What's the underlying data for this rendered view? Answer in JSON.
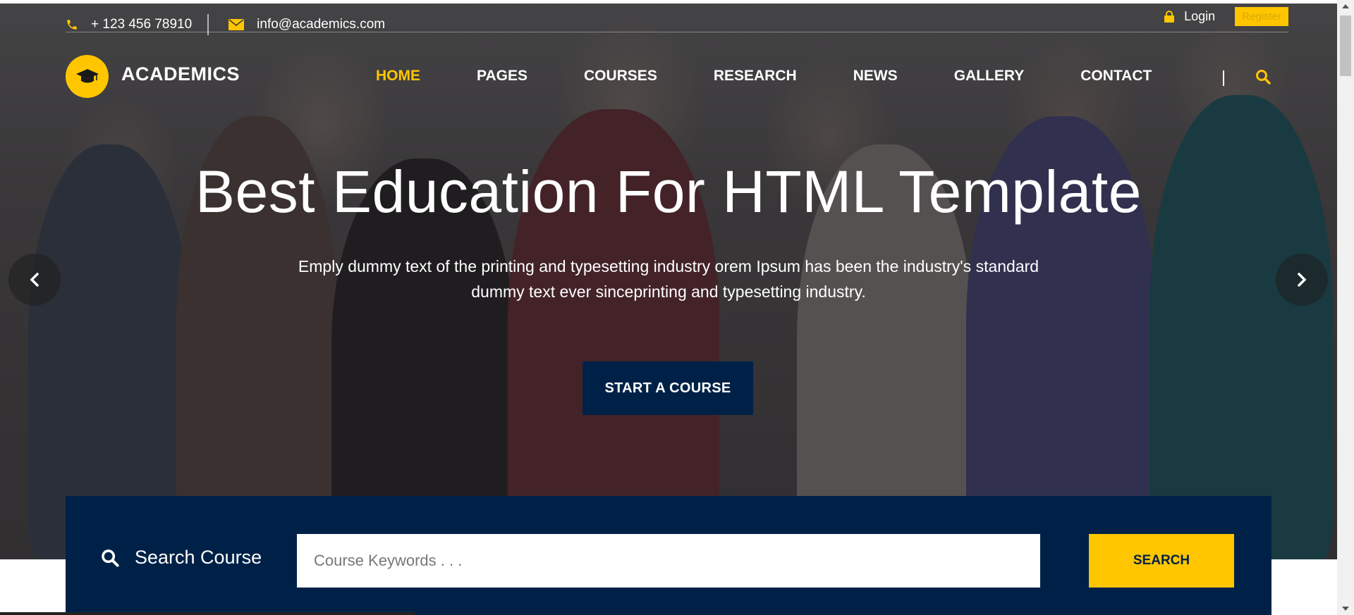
{
  "topbar": {
    "phone": "+ 123 456 78910",
    "email": "info@academics.com",
    "login": "Login",
    "register": "Register"
  },
  "brand": {
    "name": "ACADEMICS"
  },
  "nav": {
    "items": [
      {
        "label": "HOME"
      },
      {
        "label": "PAGES"
      },
      {
        "label": "COURSES"
      },
      {
        "label": "RESEARCH"
      },
      {
        "label": "NEWS"
      },
      {
        "label": "GALLERY"
      },
      {
        "label": "CONTACT"
      }
    ]
  },
  "hero": {
    "title": "Best Education For HTML Template",
    "subtitle_line1": "Emply dummy text of the printing and typesetting industry orem Ipsum has been the industry's standard",
    "subtitle_line2": "dummy text ever sinceprinting and typesetting industry.",
    "cta": "START A COURSE"
  },
  "search": {
    "label": "Search Course",
    "placeholder": "Course Keywords . . .",
    "button": "SEARCH"
  },
  "colors": {
    "accent": "#ffc600",
    "navy": "#002147"
  },
  "icons": [
    "phone-icon",
    "envelope-icon",
    "lock-icon",
    "graduation-cap-icon",
    "search-icon",
    "chevron-left-icon",
    "chevron-right-icon"
  ]
}
